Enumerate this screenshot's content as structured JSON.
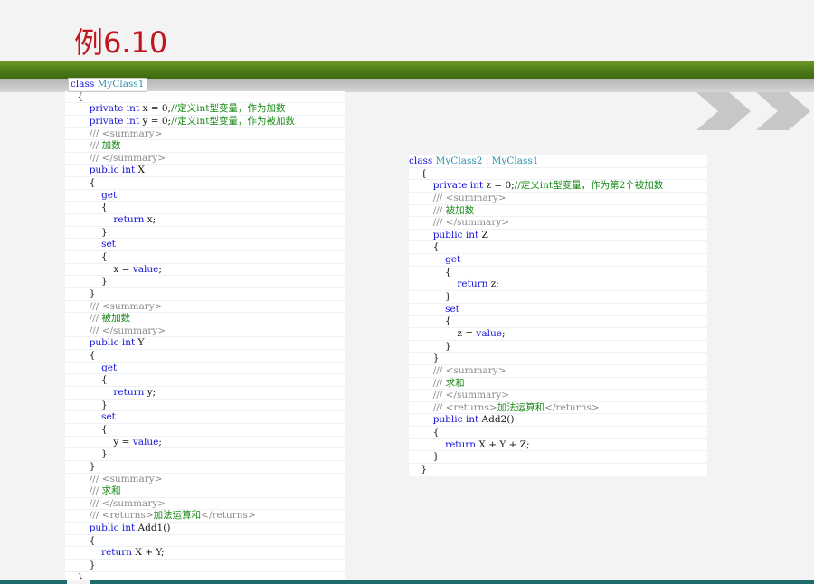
{
  "title": "例6.10",
  "left_code": [
    [
      [
        "kw",
        "class"
      ],
      [
        "pl",
        " "
      ],
      [
        "ty",
        "MyClass1"
      ]
    ],
    [
      [
        "pl",
        "    {"
      ]
    ],
    [
      [
        "pl",
        "        "
      ],
      [
        "kw",
        "private int"
      ],
      [
        "pl",
        " x = 0;"
      ],
      [
        "cm",
        "//定义int型变量，作为加数"
      ]
    ],
    [
      [
        "pl",
        "        "
      ],
      [
        "kw",
        "private int"
      ],
      [
        "pl",
        " y = 0;"
      ],
      [
        "cm",
        "//定义int型变量，作为被加数"
      ]
    ],
    [
      [
        "pl",
        "        "
      ],
      [
        "xd",
        "/// <summary>"
      ]
    ],
    [
      [
        "pl",
        "        "
      ],
      [
        "xd",
        "/// "
      ],
      [
        "cm",
        "加数"
      ]
    ],
    [
      [
        "pl",
        "        "
      ],
      [
        "xd",
        "/// </summary>"
      ]
    ],
    [
      [
        "pl",
        "        "
      ],
      [
        "kw",
        "public int"
      ],
      [
        "pl",
        " X"
      ]
    ],
    [
      [
        "pl",
        "        {"
      ]
    ],
    [
      [
        "pl",
        "            "
      ],
      [
        "kw",
        "get"
      ]
    ],
    [
      [
        "pl",
        "            {"
      ]
    ],
    [
      [
        "pl",
        "                "
      ],
      [
        "kw",
        "return"
      ],
      [
        "pl",
        " x;"
      ]
    ],
    [
      [
        "pl",
        "            }"
      ]
    ],
    [
      [
        "pl",
        "            "
      ],
      [
        "kw",
        "set"
      ]
    ],
    [
      [
        "pl",
        "            {"
      ]
    ],
    [
      [
        "pl",
        "                x = "
      ],
      [
        "kw",
        "value"
      ],
      [
        "pl",
        ";"
      ]
    ],
    [
      [
        "pl",
        "            }"
      ]
    ],
    [
      [
        "pl",
        "        }"
      ]
    ],
    [
      [
        "pl",
        "        "
      ],
      [
        "xd",
        "/// <summary>"
      ]
    ],
    [
      [
        "pl",
        "        "
      ],
      [
        "xd",
        "/// "
      ],
      [
        "cm",
        "被加数"
      ]
    ],
    [
      [
        "pl",
        "        "
      ],
      [
        "xd",
        "/// </summary>"
      ]
    ],
    [
      [
        "pl",
        "        "
      ],
      [
        "kw",
        "public int"
      ],
      [
        "pl",
        " Y"
      ]
    ],
    [
      [
        "pl",
        "        {"
      ]
    ],
    [
      [
        "pl",
        "            "
      ],
      [
        "kw",
        "get"
      ]
    ],
    [
      [
        "pl",
        "            {"
      ]
    ],
    [
      [
        "pl",
        "                "
      ],
      [
        "kw",
        "return"
      ],
      [
        "pl",
        " y;"
      ]
    ],
    [
      [
        "pl",
        "            }"
      ]
    ],
    [
      [
        "pl",
        "            "
      ],
      [
        "kw",
        "set"
      ]
    ],
    [
      [
        "pl",
        "            {"
      ]
    ],
    [
      [
        "pl",
        "                y = "
      ],
      [
        "kw",
        "value"
      ],
      [
        "pl",
        ";"
      ]
    ],
    [
      [
        "pl",
        "            }"
      ]
    ],
    [
      [
        "pl",
        "        }"
      ]
    ],
    [
      [
        "pl",
        "        "
      ],
      [
        "xd",
        "/// <summary>"
      ]
    ],
    [
      [
        "pl",
        "        "
      ],
      [
        "xd",
        "/// "
      ],
      [
        "cm",
        "求和"
      ]
    ],
    [
      [
        "pl",
        "        "
      ],
      [
        "xd",
        "/// </summary>"
      ]
    ],
    [
      [
        "pl",
        "        "
      ],
      [
        "xd",
        "/// <returns>"
      ],
      [
        "cm",
        "加法运算和"
      ],
      [
        "xd",
        "</returns>"
      ]
    ],
    [
      [
        "pl",
        "        "
      ],
      [
        "kw",
        "public int"
      ],
      [
        "pl",
        " Add1()"
      ]
    ],
    [
      [
        "pl",
        "        {"
      ]
    ],
    [
      [
        "pl",
        "            "
      ],
      [
        "kw",
        "return"
      ],
      [
        "pl",
        " X + Y;"
      ]
    ],
    [
      [
        "pl",
        "        }"
      ]
    ],
    [
      [
        "pl",
        "    }"
      ]
    ]
  ],
  "right_code": [
    [
      [
        "kw",
        "class"
      ],
      [
        "pl",
        " "
      ],
      [
        "ty",
        "MyClass2"
      ],
      [
        "pl",
        " : "
      ],
      [
        "ty",
        "MyClass1"
      ]
    ],
    [
      [
        "pl",
        "    {"
      ]
    ],
    [
      [
        "pl",
        "        "
      ],
      [
        "kw",
        "private int"
      ],
      [
        "pl",
        " z = 0;"
      ],
      [
        "cm",
        "//定义int型变量，作为第2个被加数"
      ]
    ],
    [
      [
        "pl",
        "        "
      ],
      [
        "xd",
        "/// <summary>"
      ]
    ],
    [
      [
        "pl",
        "        "
      ],
      [
        "xd",
        "/// "
      ],
      [
        "cm",
        "被加数"
      ]
    ],
    [
      [
        "pl",
        "        "
      ],
      [
        "xd",
        "/// </summary>"
      ]
    ],
    [
      [
        "pl",
        "        "
      ],
      [
        "kw",
        "public int"
      ],
      [
        "pl",
        " Z"
      ]
    ],
    [
      [
        "pl",
        "        {"
      ]
    ],
    [
      [
        "pl",
        "            "
      ],
      [
        "kw",
        "get"
      ]
    ],
    [
      [
        "pl",
        "            {"
      ]
    ],
    [
      [
        "pl",
        "                "
      ],
      [
        "kw",
        "return"
      ],
      [
        "pl",
        " z;"
      ]
    ],
    [
      [
        "pl",
        "            }"
      ]
    ],
    [
      [
        "pl",
        "            "
      ],
      [
        "kw",
        "set"
      ]
    ],
    [
      [
        "pl",
        "            {"
      ]
    ],
    [
      [
        "pl",
        "                z = "
      ],
      [
        "kw",
        "value"
      ],
      [
        "pl",
        ";"
      ]
    ],
    [
      [
        "pl",
        "            }"
      ]
    ],
    [
      [
        "pl",
        "        }"
      ]
    ],
    [
      [
        "pl",
        "        "
      ],
      [
        "xd",
        "/// <summary>"
      ]
    ],
    [
      [
        "pl",
        "        "
      ],
      [
        "xd",
        "/// "
      ],
      [
        "cm",
        "求和"
      ]
    ],
    [
      [
        "pl",
        "        "
      ],
      [
        "xd",
        "/// </summary>"
      ]
    ],
    [
      [
        "pl",
        "        "
      ],
      [
        "xd",
        "/// <returns>"
      ],
      [
        "cm",
        "加法运算和"
      ],
      [
        "xd",
        "</returns>"
      ]
    ],
    [
      [
        "pl",
        "        "
      ],
      [
        "kw",
        "public int"
      ],
      [
        "pl",
        " Add2()"
      ]
    ],
    [
      [
        "pl",
        "        {"
      ]
    ],
    [
      [
        "pl",
        "            "
      ],
      [
        "kw",
        "return"
      ],
      [
        "pl",
        " X + Y + Z;"
      ]
    ],
    [
      [
        "pl",
        "        }"
      ]
    ],
    [
      [
        "pl",
        "    }"
      ]
    ]
  ],
  "colors": {
    "title": "#c0161c",
    "keyword": "#1414d8",
    "comment": "#1a8a1a",
    "xmldoc": "#8a8a8a",
    "type": "#2b91af",
    "band_green": "#4d7a17",
    "band_bottom": "#1f6b6b"
  },
  "icons": {
    "decoration": "double-chevron-right-icon"
  }
}
